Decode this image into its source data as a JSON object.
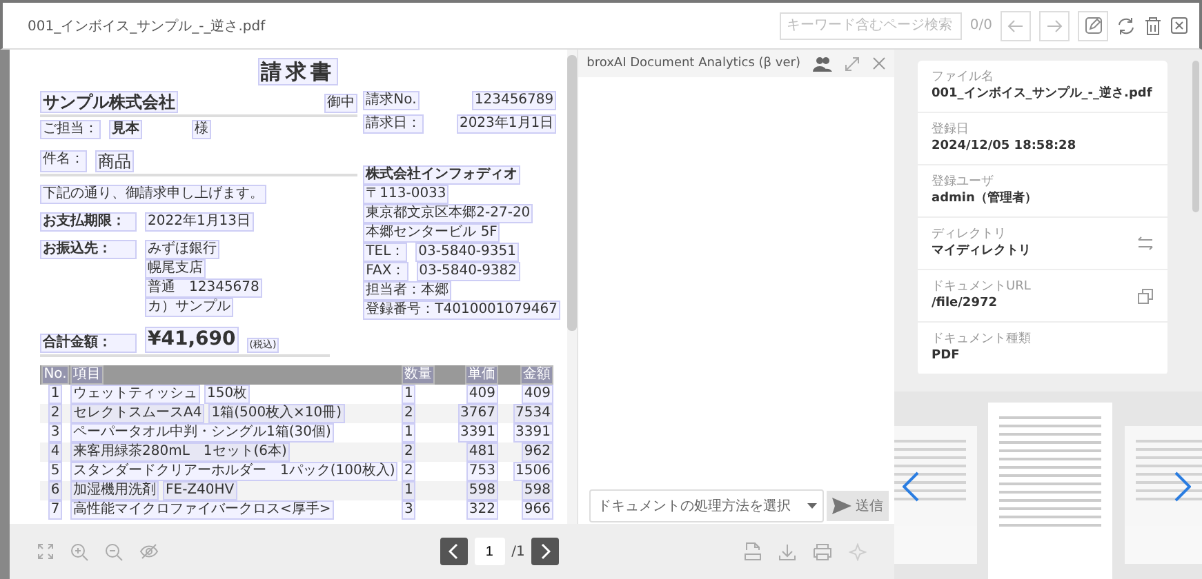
{
  "file_title": "001_インボイス_サンプル_-_逆さ.pdf",
  "search": {
    "placeholder": "キーワード含むページ検索",
    "count": "0/0"
  },
  "document": {
    "title": "請求書",
    "client": "サンプル株式会社",
    "client_suffix": "御中",
    "contact_label": "ご担当：",
    "contact": "見本",
    "contact_suffix": "様",
    "meta": [
      {
        "label": "請求No.",
        "value": "123456789"
      },
      {
        "label": "請求日：",
        "value": "2023年1月1日"
      }
    ],
    "subject_label": "件名：",
    "subject": "商品",
    "message": "下記の通り、御請求申し上げます。",
    "due_label": "お支払期限：",
    "due": "2022年1月13日",
    "bank_label": "お振込先：",
    "bank": [
      "みずほ銀行",
      "幌尾支店",
      "普通　12345678",
      "カ）サンプル"
    ],
    "sender": [
      [
        "株式会社インフォディオ"
      ],
      [
        "〒113-0033"
      ],
      [
        "東京都文京区本郷2-27-20"
      ],
      [
        "本郷センタービル 5F"
      ],
      [
        "TEL：",
        "03-5840-9351"
      ],
      [
        "FAX：",
        "03-5840-9382"
      ],
      [
        "担当者：本郷"
      ],
      [
        "登録番号：T4010001079467"
      ]
    ],
    "total_label": "合計金額：",
    "total": "¥41,690",
    "total_note": "(税込)",
    "columns": [
      "No.",
      "項目",
      "数量",
      "単価",
      "金額"
    ],
    "rows": [
      {
        "no": "1",
        "item": [
          "ウェットティッシュ",
          "150枚"
        ],
        "qty": "1",
        "price": "409",
        "amount": "409"
      },
      {
        "no": "2",
        "item": [
          "セレクトスムースA4",
          "1箱(500枚入×10冊)"
        ],
        "qty": "2",
        "price": "3767",
        "amount": "7534"
      },
      {
        "no": "3",
        "item": [
          "ペーパータオル中判・シングル1箱(30個)"
        ],
        "qty": "1",
        "price": "3391",
        "amount": "3391"
      },
      {
        "no": "4",
        "item": [
          "来客用緑茶280mL　1セット(6本)"
        ],
        "qty": "2",
        "price": "481",
        "amount": "962"
      },
      {
        "no": "5",
        "item": [
          "スタンダードクリアーホルダー　1パック(100枚入)"
        ],
        "qty": "2",
        "price": "753",
        "amount": "1506"
      },
      {
        "no": "6",
        "item": [
          "加湿機用洗剤",
          "FE-Z40HV"
        ],
        "qty": "1",
        "price": "598",
        "amount": "598"
      },
      {
        "no": "7",
        "item": [
          "高性能マイクロファイバークロス<厚手>"
        ],
        "qty": "3",
        "price": "322",
        "amount": "966"
      }
    ]
  },
  "chat": {
    "title": "broxAI Document Analytics (β ver)",
    "select_placeholder": "ドキュメントの処理方法を選択",
    "send_label": "送信",
    "send_disabled": true
  },
  "pager": {
    "page": "1",
    "total": "/1"
  },
  "info": [
    {
      "label": "ファイル名",
      "value": "001_インボイス_サンプル_-_逆さ.pdf",
      "kind": "plain"
    },
    {
      "label": "登録日",
      "value": "2024/12/05 18:58:28",
      "kind": "plain"
    },
    {
      "label": "登録ユーザ",
      "value": "admin（管理者）",
      "kind": "plain"
    },
    {
      "label": "ディレクトリ",
      "value": "マイディレクトリ",
      "kind": "movable"
    },
    {
      "label": "ドキュメントURL",
      "value": "/file/2972",
      "kind": "copyable"
    },
    {
      "label": "ドキュメント種類",
      "value": "PDF",
      "kind": "plain"
    }
  ]
}
